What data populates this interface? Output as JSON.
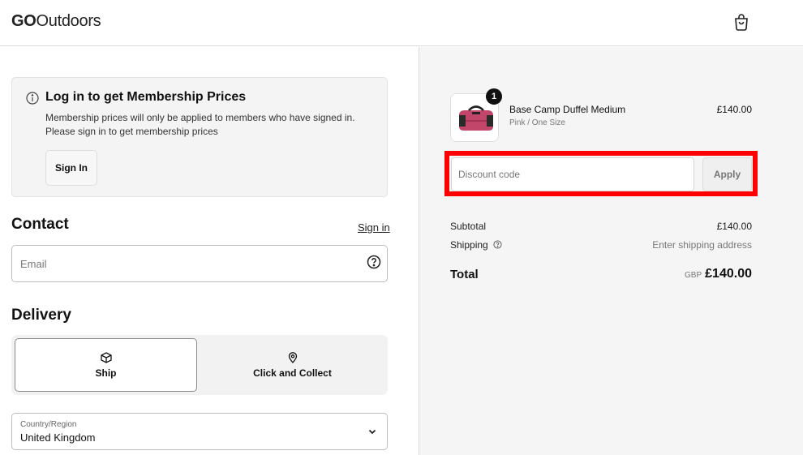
{
  "header": {
    "logo_bold": "GO",
    "logo_rest": "Outdoors",
    "cart_icon": "shopping-bag-icon"
  },
  "membership": {
    "title": "Log in to get Membership Prices",
    "text": "Membership prices will only be applied to members who have signed in. Please sign in to get membership prices",
    "button": "Sign In",
    "icon": "info-icon"
  },
  "contact": {
    "title": "Contact",
    "signin_link": "Sign in",
    "email_placeholder": "Email",
    "help_icon": "question-circle-icon"
  },
  "delivery": {
    "title": "Delivery",
    "options": [
      {
        "label": "Ship",
        "icon": "box-icon",
        "selected": true
      },
      {
        "label": "Click and Collect",
        "icon": "location-pin-icon",
        "selected": false
      }
    ],
    "country_label": "Country/Region",
    "country_value": "United Kingdom"
  },
  "order": {
    "item": {
      "quantity": "1",
      "name": "Base Camp Duffel Medium",
      "variant": "Pink / One Size",
      "price": "£140.00"
    },
    "discount_placeholder": "Discount code",
    "apply_label": "Apply",
    "subtotal_label": "Subtotal",
    "subtotal_value": "£140.00",
    "shipping_label": "Shipping",
    "shipping_value": "Enter shipping address",
    "total_label": "Total",
    "total_currency": "GBP",
    "total_value": "£140.00"
  },
  "colors": {
    "highlight": "#ff0000",
    "summary_bg": "#f5f5f5",
    "text": "#111111"
  }
}
